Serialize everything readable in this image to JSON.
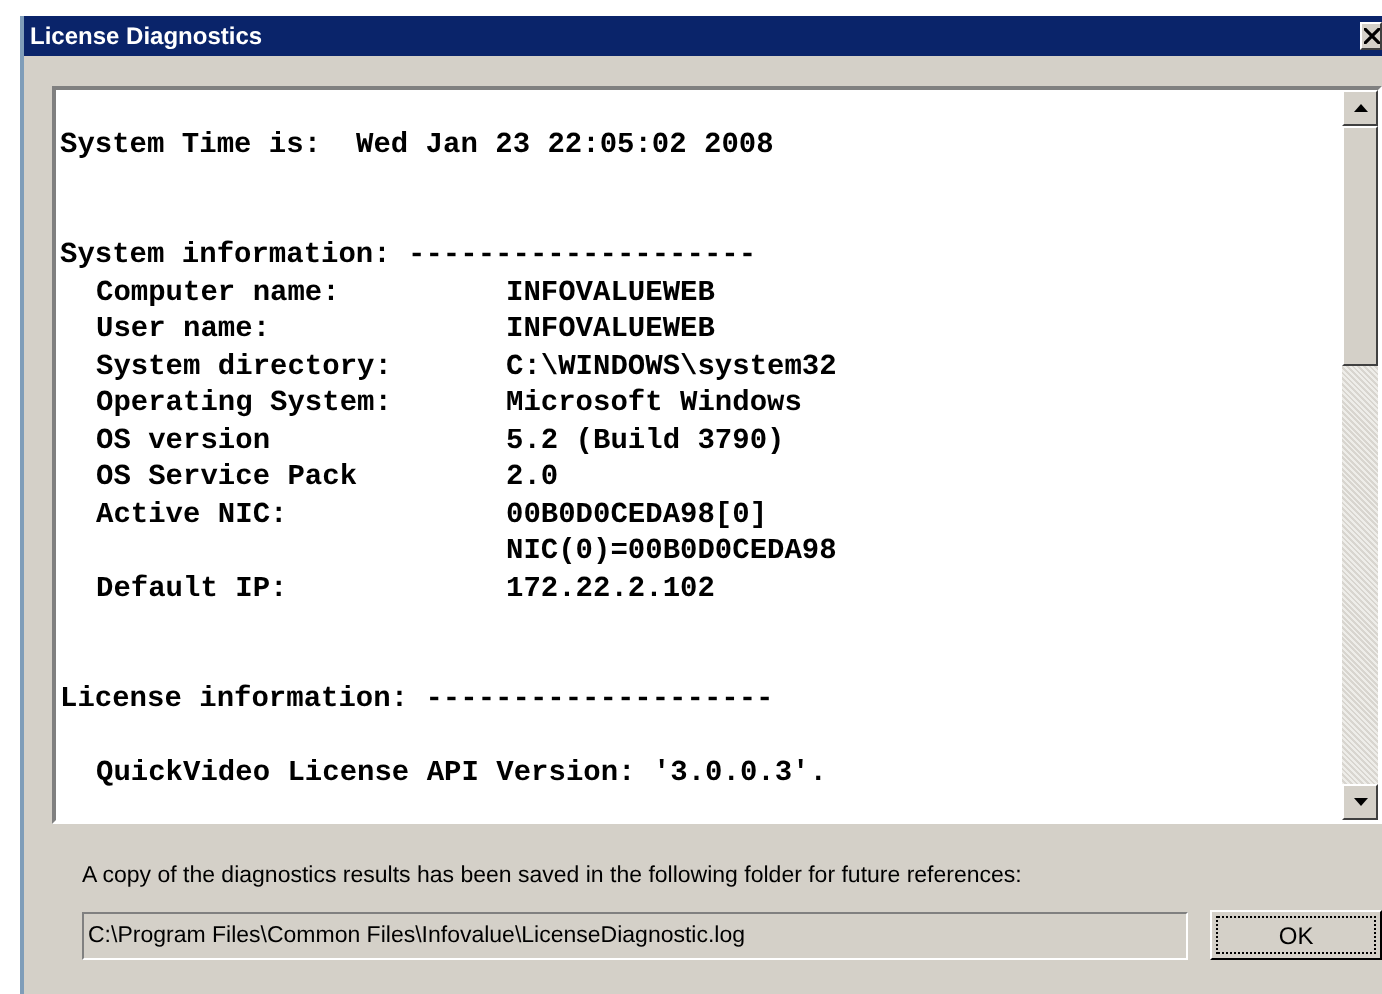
{
  "window": {
    "title": "License Diagnostics"
  },
  "report": {
    "system_time": {
      "label": "System Time is:",
      "value": "Wed Jan 23 22:05:02 2008"
    },
    "system_information": {
      "heading": "System information: --------------------",
      "rows": [
        {
          "label": "Computer name:",
          "value": "INFOVALUEWEB"
        },
        {
          "label": "User name:",
          "value": "INFOVALUEWEB"
        },
        {
          "label": "System directory:",
          "value": "C:\\WINDOWS\\system32"
        },
        {
          "label": "Operating System:",
          "value": "Microsoft Windows"
        },
        {
          "label": "OS version",
          "value": "5.2 (Build 3790)"
        },
        {
          "label": "OS Service Pack",
          "value": "2.0"
        },
        {
          "label": "Active NIC:",
          "value": "00B0D0CEDA98[0]"
        },
        {
          "value": "NIC(0)=00B0D0CEDA98"
        },
        {
          "label": "Default IP:",
          "value": "172.22.2.102"
        }
      ]
    },
    "license_information": {
      "heading": "License information: --------------------",
      "lines": [
        "QuickVideo License API Version: '3.0.0.3'."
      ]
    }
  },
  "footer": {
    "message": "A copy of the diagnostics results has been saved in the following folder for future references:",
    "log_path": "C:\\Program Files\\Common Files\\Infovalue\\LicenseDiagnostic.log",
    "ok_button": "OK"
  }
}
